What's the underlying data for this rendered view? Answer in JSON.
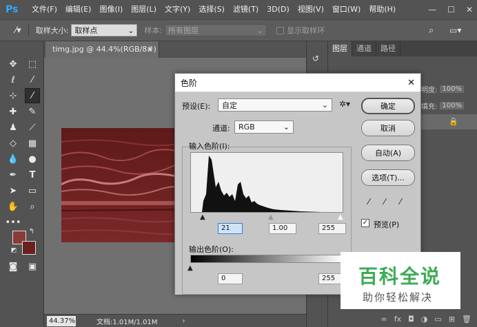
{
  "app": {
    "logo": "Ps"
  },
  "menu": [
    "文件(F)",
    "编辑(E)",
    "图像(I)",
    "图层(L)",
    "文字(Y)",
    "选择(S)",
    "滤镜(T)",
    "3D(D)",
    "视图(V)",
    "窗口(W)",
    "帮助(H)"
  ],
  "window_controls": {
    "minimize": "—",
    "maximize": "☐",
    "close": "✕"
  },
  "options": {
    "sample_size_label": "取样大小:",
    "sample_size_value": "取样点",
    "sample_label": "样本:",
    "sample_value": "所有图层",
    "show_ring_label": "显示取样环"
  },
  "document": {
    "tab_title": "timg.jpg @ 44.4%(RGB/8#) *",
    "close": "×"
  },
  "status": {
    "zoom": "44.37%",
    "doc_info": "文档:1.01M/1.01M",
    "arrow": "›"
  },
  "right_panel": {
    "tabs": [
      "图层",
      "通道",
      "路径"
    ],
    "opacity_label": "明度:",
    "opacity_value": "100%",
    "fill_label": "填充:",
    "fill_value": "100%"
  },
  "dialog": {
    "title": "色阶",
    "close": "✕",
    "preset_label": "预设(E):",
    "preset_value": "自定",
    "channel_label": "通道:",
    "channel_value": "RGB",
    "input_label": "输入色阶(I):",
    "input_black": "21",
    "input_mid": "1.00",
    "input_white": "255",
    "output_label": "输出色阶(O):",
    "output_black": "0",
    "output_white": "255",
    "buttons": {
      "ok": "确定",
      "cancel": "取消",
      "auto": "自动(A)",
      "options": "选项(T)..."
    },
    "preview_label": "预览(P)",
    "preview_checked": true
  },
  "watermark": {
    "title": "百科全说",
    "subtitle": "助你轻松解决"
  },
  "colors": {
    "foreground": "#8b3a3a",
    "background": "#6b2020",
    "wm_green": "#3bab55"
  }
}
